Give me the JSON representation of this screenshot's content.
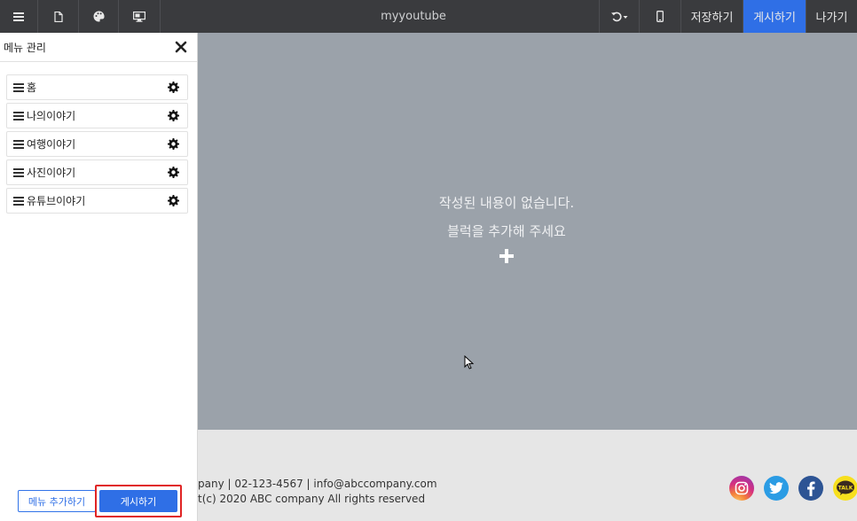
{
  "app": {
    "title": "myyoutube"
  },
  "toolbar": {
    "save_label": "저장하기",
    "publish_label": "게시하기",
    "exit_label": "나가기"
  },
  "sidebar": {
    "title": "메뉴 관리",
    "items": [
      {
        "label": "홈"
      },
      {
        "label": "나의이야기"
      },
      {
        "label": "여행이야기"
      },
      {
        "label": "사진이야기"
      },
      {
        "label": "유튜브이야기"
      }
    ],
    "add_menu_label": "메뉴 추가하기",
    "publish_label": "게시하기"
  },
  "canvas": {
    "empty_line1": "작성된 내용이 없습니다.",
    "empty_line2": "블럭을 추가해 주세요"
  },
  "footer": {
    "contact": "pany | 02-123-4567 | info@abccompany.com",
    "copyright": "t(c) 2020 ABC company All rights reserved",
    "social": [
      "instagram-icon",
      "twitter-icon",
      "facebook-icon",
      "kakaotalk-icon"
    ],
    "kakao_text": "TALK"
  },
  "colors": {
    "topbar": "#3a3b3e",
    "accent": "#2f6fe6",
    "canvas": "#9ba2aa",
    "highlight": "#e02424"
  }
}
